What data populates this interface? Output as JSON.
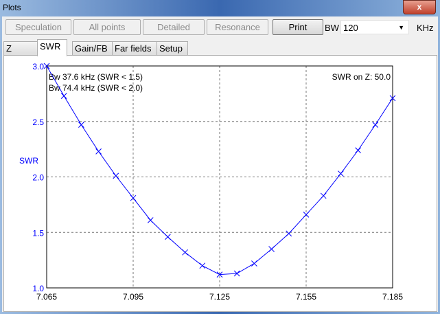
{
  "window": {
    "title": "Plots",
    "close_label": "x"
  },
  "toolbar": {
    "buttons": [
      "Speculation",
      "All points",
      "Detailed",
      "Resonance",
      "Print"
    ],
    "bw_label": "BW",
    "bw_value": "120",
    "unit": "KHz"
  },
  "tabs": [
    "Z",
    "SWR",
    "Gain/FB",
    "Far fields",
    "Setup"
  ],
  "selected_tab": "SWR",
  "annotations": {
    "bw1": "Bw 37.6 kHz (SWR < 1.5)",
    "bw2": "Bw 74.4 kHz (SWR < 2.0)",
    "swr_on_z": "SWR on Z: 50.0"
  },
  "chart_data": {
    "type": "line",
    "ylabel": "SWR",
    "xlabel": "",
    "xlim": [
      7.065,
      7.185
    ],
    "ylim": [
      1.0,
      3.0
    ],
    "xticks": [
      "7.065",
      "7.095",
      "7.125",
      "7.155",
      "7.185"
    ],
    "yticks": [
      "3.0",
      "2.5",
      "2.0",
      "1.5",
      "1.0"
    ],
    "grid": true,
    "color": "#0000ff",
    "x": [
      7.065,
      7.071,
      7.077,
      7.083,
      7.089,
      7.095,
      7.101,
      7.107,
      7.113,
      7.119,
      7.125,
      7.131,
      7.137,
      7.143,
      7.149,
      7.155,
      7.161,
      7.167,
      7.173,
      7.179,
      7.185
    ],
    "y": [
      3.0,
      2.73,
      2.47,
      2.23,
      2.01,
      1.81,
      1.61,
      1.46,
      1.32,
      1.2,
      1.12,
      1.13,
      1.22,
      1.35,
      1.49,
      1.66,
      1.83,
      2.03,
      2.24,
      2.47,
      2.71
    ]
  }
}
